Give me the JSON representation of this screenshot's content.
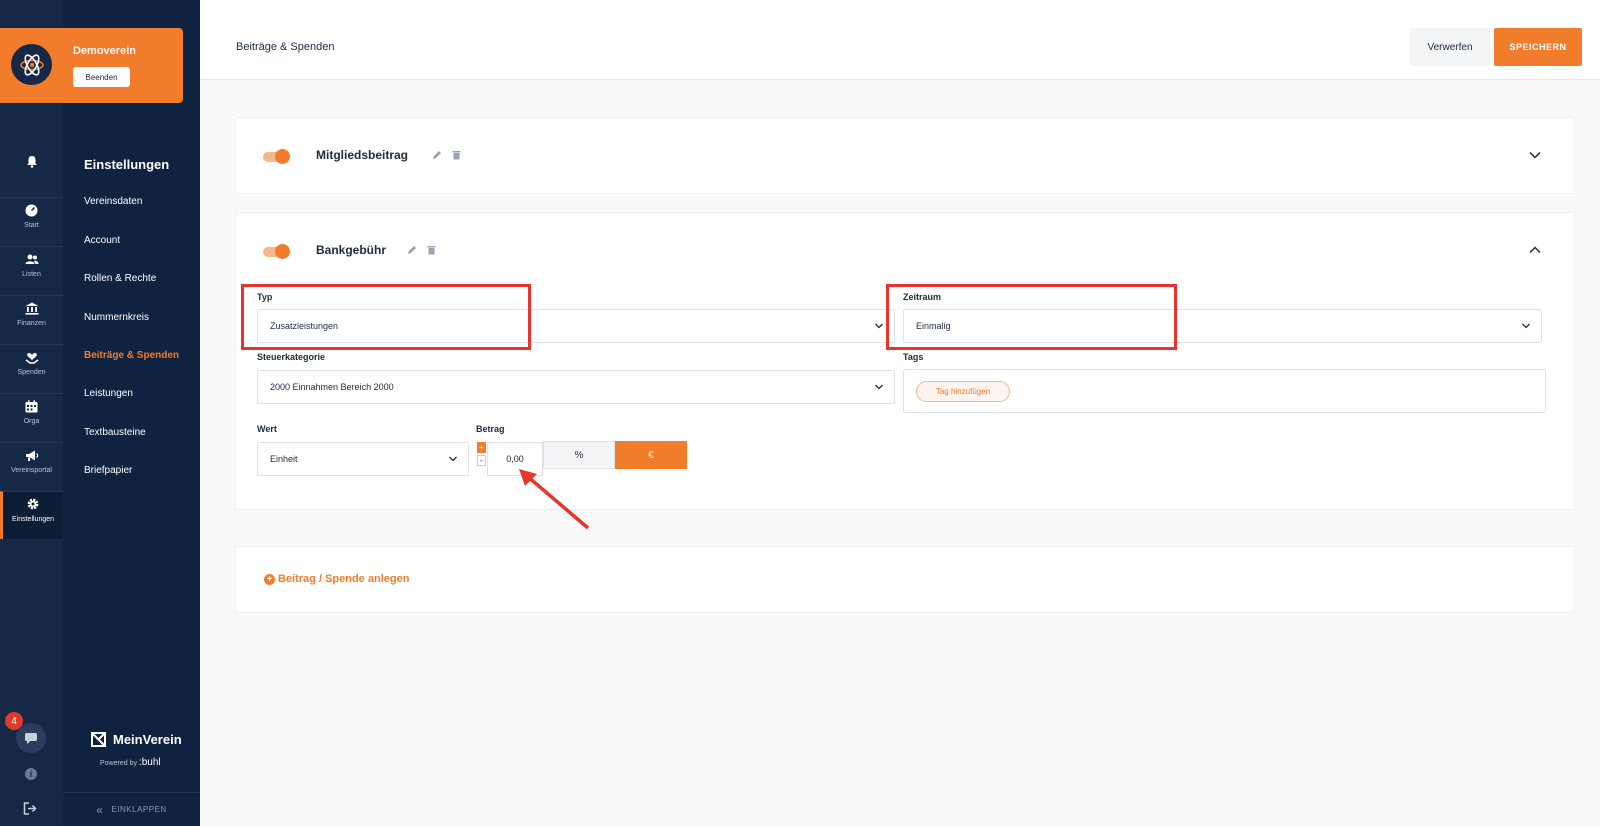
{
  "org": {
    "name": "Demoverein",
    "end_button": "Beenden"
  },
  "rail": {
    "items": [
      {
        "label": "Start",
        "icon": "dashboard-icon"
      },
      {
        "label": "Listen",
        "icon": "users-icon"
      },
      {
        "label": "Finanzen",
        "icon": "bank-icon"
      },
      {
        "label": "Spenden",
        "icon": "donation-icon"
      },
      {
        "label": "Orga",
        "icon": "calendar-icon"
      },
      {
        "label": "Vereinsportal",
        "icon": "megaphone-icon"
      },
      {
        "label": "Einstellungen",
        "icon": "gear-icon"
      }
    ],
    "chat_badge": "4"
  },
  "settings_nav": {
    "title": "Einstellungen",
    "items": [
      "Vereinsdaten",
      "Account",
      "Rollen & Rechte",
      "Nummernkreis",
      "Beiträge & Spenden",
      "Leistungen",
      "Textbausteine",
      "Briefpapier"
    ],
    "active": "Beiträge & Spenden"
  },
  "brand": {
    "name": "MeinVerein",
    "powered_by": "Powered by",
    "powered_brand": ":buhl"
  },
  "collapse_label": "EINKLAPPEN",
  "header": {
    "title": "Beiträge & Spenden",
    "discard_label": "Verwerfen",
    "save_label": "SPEICHERN"
  },
  "cards": {
    "membership": {
      "title": "Mitgliedsbeitrag"
    },
    "bank_fee": {
      "title": "Bankgebühr",
      "typ_label": "Typ",
      "typ_value": "Zusatzleistungen",
      "zeitraum_label": "Zeitraum",
      "zeitraum_value": "Einmalig",
      "steuer_label": "Steuerkategorie",
      "steuer_value": "2000 Einnahmen Bereich 2000",
      "tags_label": "Tags",
      "tag_add": "Tag hinzufügen",
      "wert_label": "Wert",
      "wert_value": "Einheit",
      "betrag_label": "Betrag",
      "betrag_value": "0,00",
      "unit_percent": "%",
      "unit_euro": "€",
      "stepper_plus": "+",
      "stepper_minus": "-"
    }
  },
  "add_link": "Beitrag / Spende anlegen",
  "colors": {
    "accent": "#f07c2c",
    "sidebar": "#152947",
    "highlight": "#e8352c"
  }
}
